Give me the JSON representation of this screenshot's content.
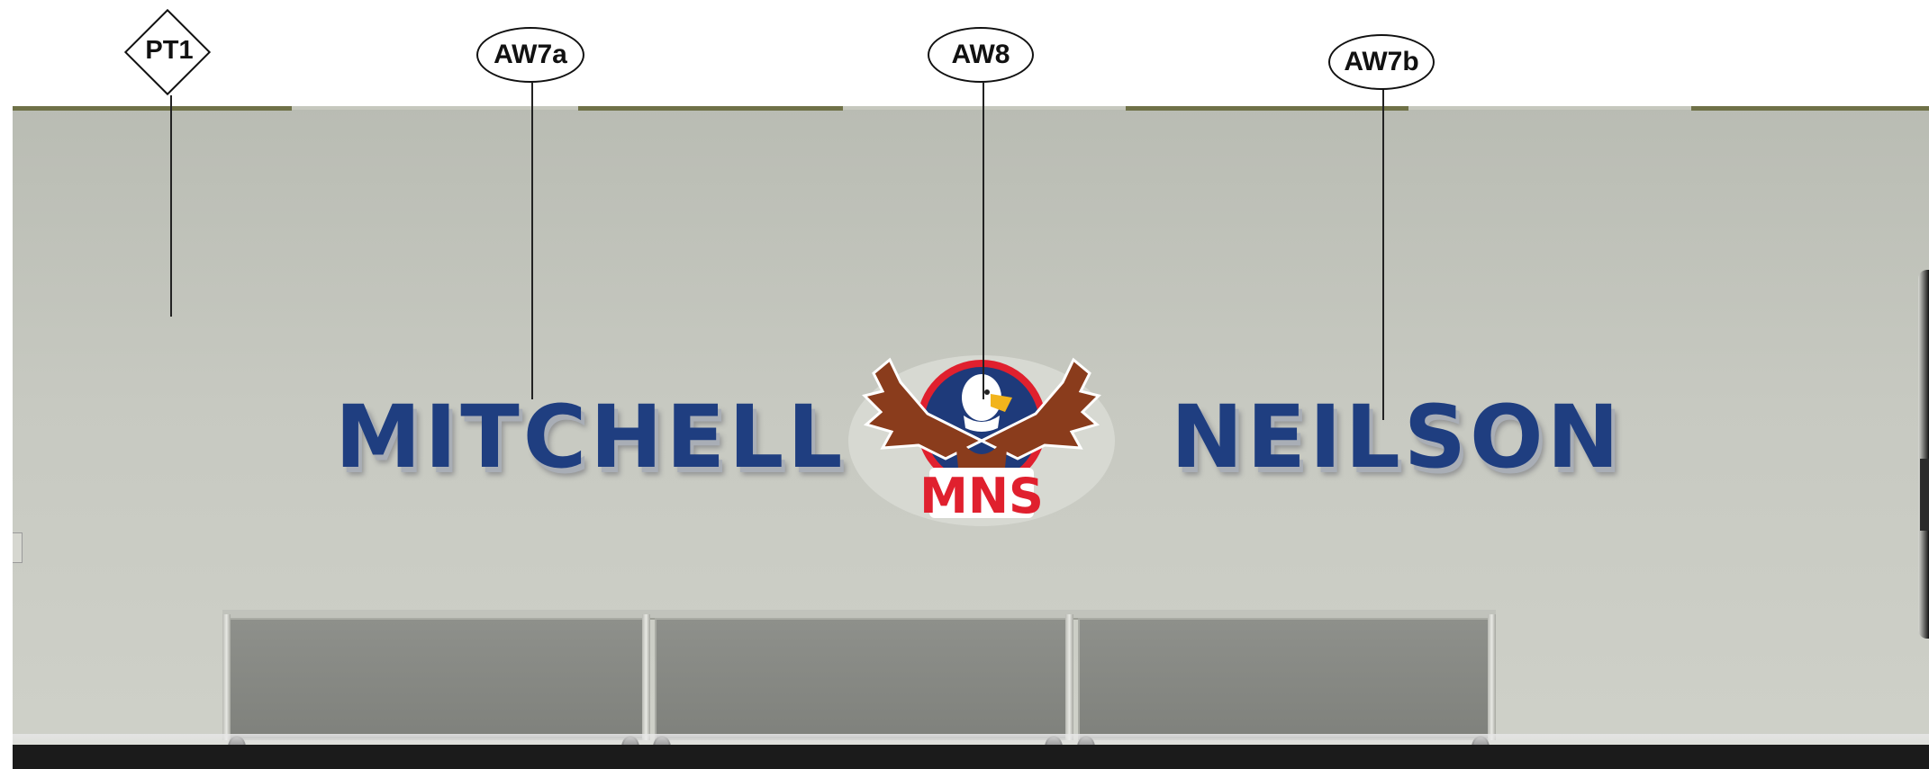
{
  "callouts": {
    "pt1": "PT1",
    "aw7a": "AW7a",
    "aw8": "AW8",
    "aw7b": "AW7b"
  },
  "signage": {
    "left_word": "MITCHELL",
    "right_word": "NEILSON",
    "logo_text": "MNS"
  },
  "colors": {
    "letter_blue": "#1f3e80",
    "logo_red": "#e0202e",
    "logo_navy": "#1e3a7a",
    "eagle_brown": "#8a3c1c",
    "beak_yellow": "#f2b41c",
    "wall": "#c3c5bd"
  },
  "icons": {
    "mascot": "eagle-icon"
  }
}
